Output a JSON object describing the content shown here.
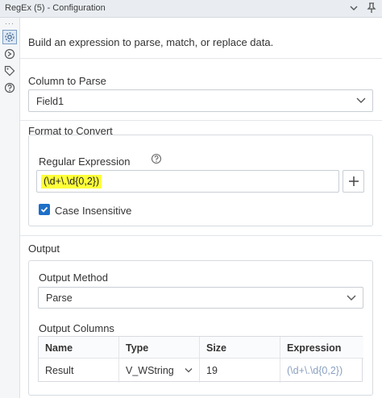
{
  "window": {
    "title": "RegEx (5) - Configuration",
    "collapse_icon": "chevron-down-icon",
    "pin_icon": "pin-icon"
  },
  "rail": {
    "items": [
      {
        "icon": "gear-icon",
        "active": true
      },
      {
        "icon": "navigate-icon",
        "active": false
      },
      {
        "icon": "tag-icon",
        "active": false
      },
      {
        "icon": "help-icon",
        "active": false
      }
    ]
  },
  "intro": "Build an expression to parse, match, or replace data.",
  "column_to_parse": {
    "label": "Column to Parse",
    "value": "Field1"
  },
  "format_to_convert": {
    "label": "Format to Convert",
    "regex_label": "Regular Expression",
    "regex_value": "(\\d+\\.\\d{0,2})",
    "add_label": "+",
    "case_insensitive_label": "Case Insensitive",
    "case_insensitive_checked": true
  },
  "output": {
    "label": "Output",
    "method_label": "Output Method",
    "method_value": "Parse",
    "columns_label": "Output Columns",
    "table": {
      "headers": [
        "Name",
        "Type",
        "Size",
        "Expression"
      ],
      "rows": [
        {
          "name": "Result",
          "type": "V_WString",
          "size": "19",
          "expression": "(\\d+\\.\\d{0,2})"
        }
      ]
    }
  },
  "colors": {
    "accent": "#1d6fc9",
    "highlight": "#ffff3a"
  }
}
